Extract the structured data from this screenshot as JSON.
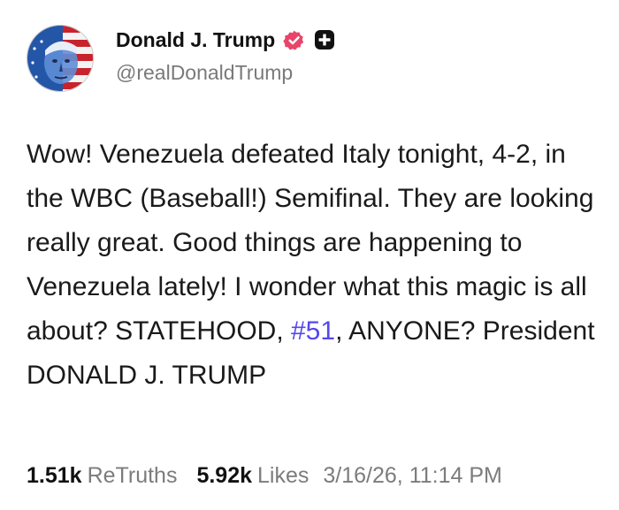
{
  "author": {
    "display_name": "Donald J. Trump",
    "handle": "@realDonaldTrump",
    "verified_badge_color": "#e9446a",
    "avatar_icon": "flag-portrait-avatar",
    "badge_icon": "plus-badge-icon"
  },
  "post": {
    "text_before_hashtag": "Wow! Venezuela defeated Italy tonight, 4-2, in the WBC (Baseball!) Semifinal. They are looking really great. Good things are happening to Venezuela lately! I wonder what this magic is all about? STATEHOOD, ",
    "hashtag": "#51",
    "text_after_hashtag": ", ANYONE? President DONALD J. TRUMP",
    "hashtag_color": "#5448ee"
  },
  "stats": {
    "retruths_count": "1.51k",
    "retruths_label": "ReTruths",
    "likes_count": "5.92k",
    "likes_label": "Likes",
    "timestamp": "3/16/26, 11:14 PM"
  }
}
